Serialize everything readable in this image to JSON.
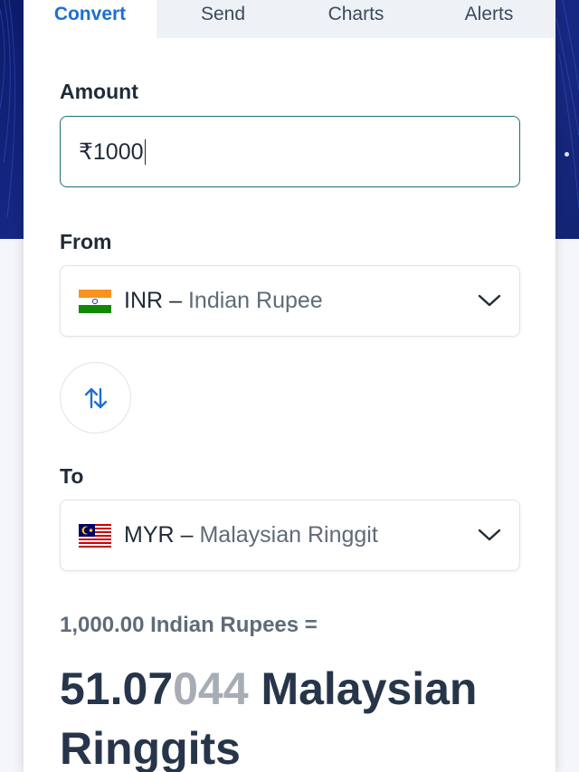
{
  "tabs": [
    {
      "label": "Convert",
      "active": true
    },
    {
      "label": "Send",
      "active": false
    },
    {
      "label": "Charts",
      "active": false
    },
    {
      "label": "Alerts",
      "active": false
    }
  ],
  "amount": {
    "label": "Amount",
    "value": "₹1000"
  },
  "from": {
    "label": "From",
    "code": "INR",
    "separator": "–",
    "name": "Indian Rupee",
    "flag": "india-flag"
  },
  "to": {
    "label": "To",
    "code": "MYR",
    "separator": "–",
    "name": "Malaysian Ringgit",
    "flag": "malaysia-flag"
  },
  "swap": {
    "icon": "swap-arrows-icon"
  },
  "result": {
    "from_text": "1,000.00 Indian Rupees =",
    "to_main": "51.07",
    "to_faded": "044",
    "to_unit": " Malaysian Ringgits"
  },
  "colors": {
    "accent": "#1d6fd4",
    "hero": "#1a2c8f",
    "input_border": "#1e6f73"
  }
}
